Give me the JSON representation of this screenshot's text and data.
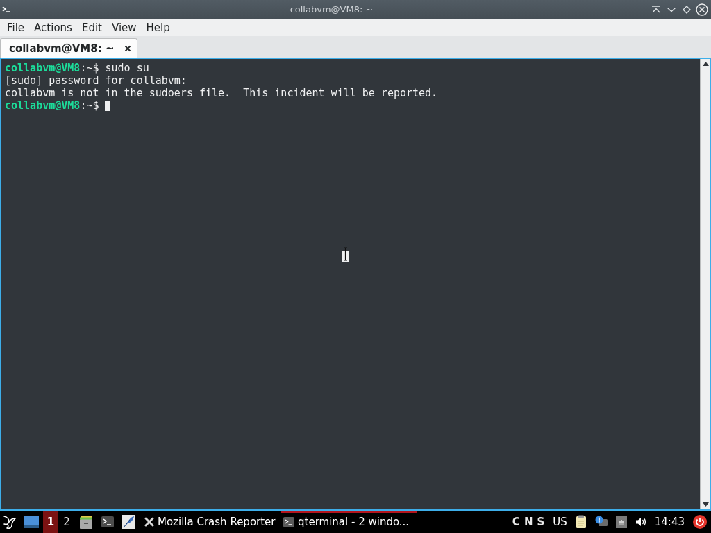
{
  "window": {
    "title": "collabvm@VM8: ~"
  },
  "menu": [
    "File",
    "Actions",
    "Edit",
    "View",
    "Help"
  ],
  "tabs": [
    {
      "label": "collabvm@VM8: ~",
      "selected": true
    }
  ],
  "terminal": {
    "lines": [
      {
        "kind": "prompt",
        "user": "collabvm@VM8",
        "prompt": ":~$",
        "command": "sudo su",
        "cursor": false
      },
      {
        "kind": "output",
        "text": "[sudo] password for collabvm:"
      },
      {
        "kind": "output",
        "text": "collabvm is not in the sudoers file.  This incident will be reported."
      },
      {
        "kind": "prompt",
        "user": "collabvm@VM8",
        "prompt": ":~$",
        "cursor": true
      }
    ]
  },
  "taskbar": {
    "workspaces": [
      {
        "label": "1",
        "selected": true
      },
      {
        "label": "2",
        "selected": false
      }
    ],
    "tasks": [
      {
        "kind": "reporter",
        "label": "Mozilla Crash Reporter",
        "selected": false
      },
      {
        "kind": "terminal",
        "label": "qterminal - 2 windo...",
        "selected": true
      }
    ],
    "lock_keys": [
      "C",
      "N",
      "S"
    ],
    "keyboard_layout": "US",
    "clock": "14:43"
  }
}
